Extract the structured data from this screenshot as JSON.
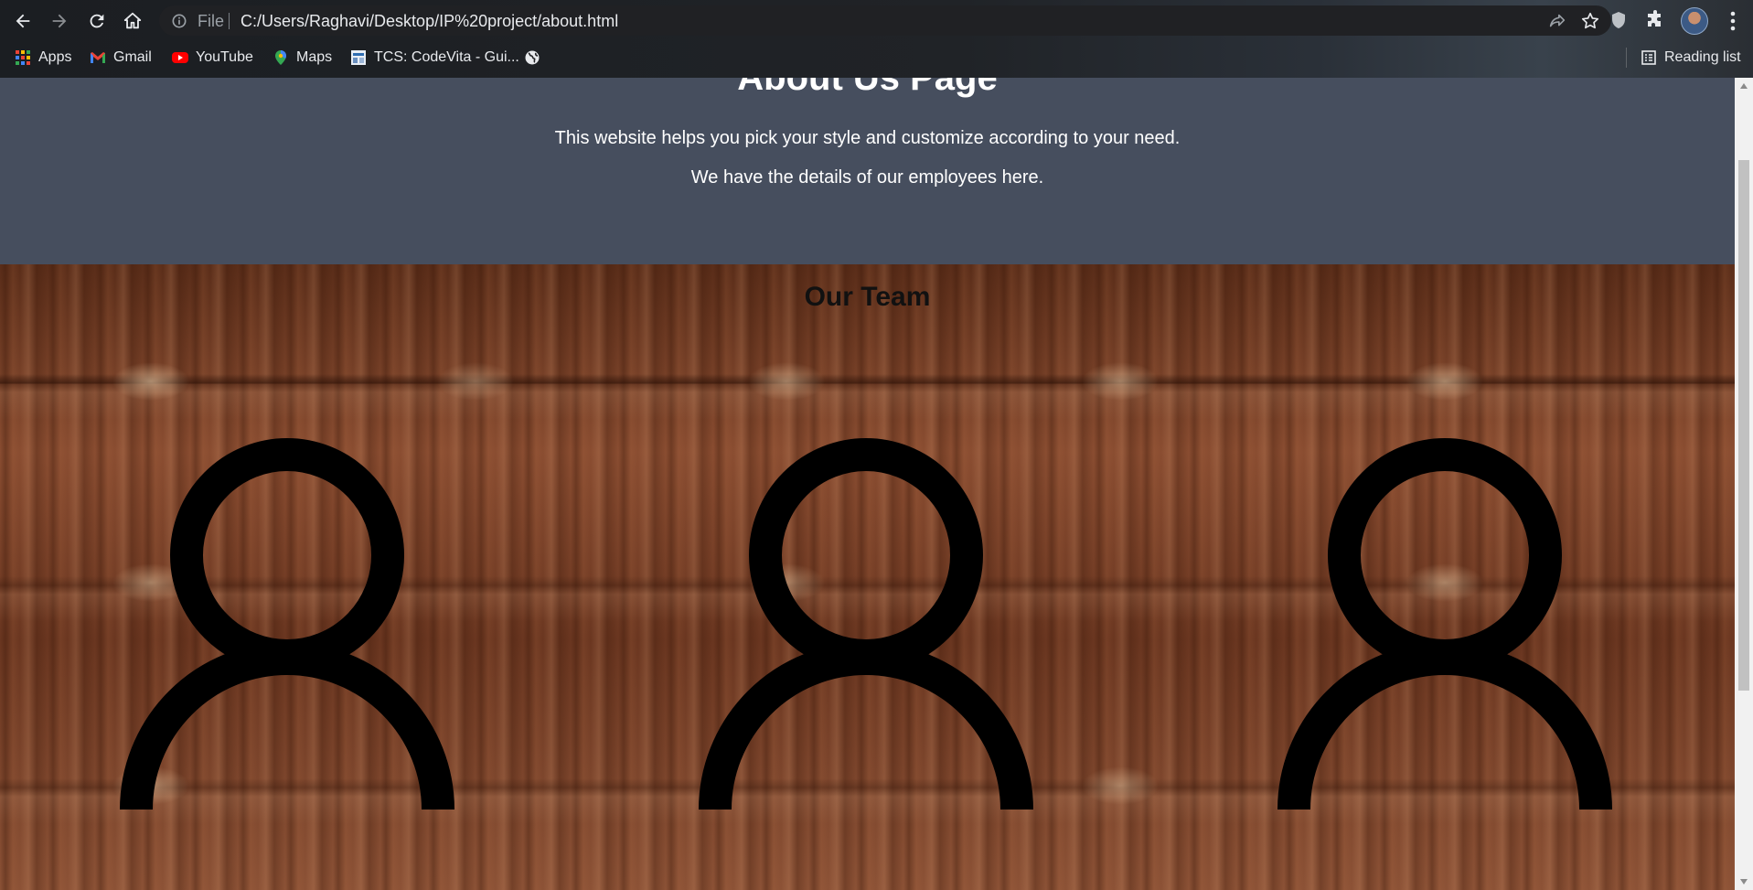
{
  "browser": {
    "address": {
      "scheme_label": "File",
      "url": "C:/Users/Raghavi/Desktop/IP%20project/about.html"
    },
    "icons": [
      "back-icon",
      "forward-icon",
      "reload-icon",
      "home-icon",
      "info-icon",
      "share-icon",
      "star-icon",
      "shield-icon",
      "extensions-icon",
      "avatar",
      "menu-icon"
    ],
    "bookmarks": [
      {
        "label": "Apps",
        "icon": "apps-icon"
      },
      {
        "label": "Gmail",
        "icon": "gmail-icon"
      },
      {
        "label": "YouTube",
        "icon": "youtube-icon"
      },
      {
        "label": "Maps",
        "icon": "maps-icon"
      },
      {
        "label": "TCS: CodeVita - Gui...",
        "icon": "tcs-icon"
      },
      {
        "label": "",
        "icon": "globe-icon"
      }
    ],
    "reading_list_label": "Reading list"
  },
  "page": {
    "about": {
      "title": "About Us Page",
      "line1": "This website helps you pick your style and customize according to your need.",
      "line2": "We have the details of our employees here."
    },
    "team": {
      "title": "Our Team",
      "members": [
        {
          "icon": "person-icon"
        },
        {
          "icon": "person-icon"
        },
        {
          "icon": "person-icon"
        }
      ]
    }
  },
  "colors": {
    "about_bg": "#464e5e",
    "chrome_bg": "#202124",
    "wood_bg": "#7b4429"
  }
}
